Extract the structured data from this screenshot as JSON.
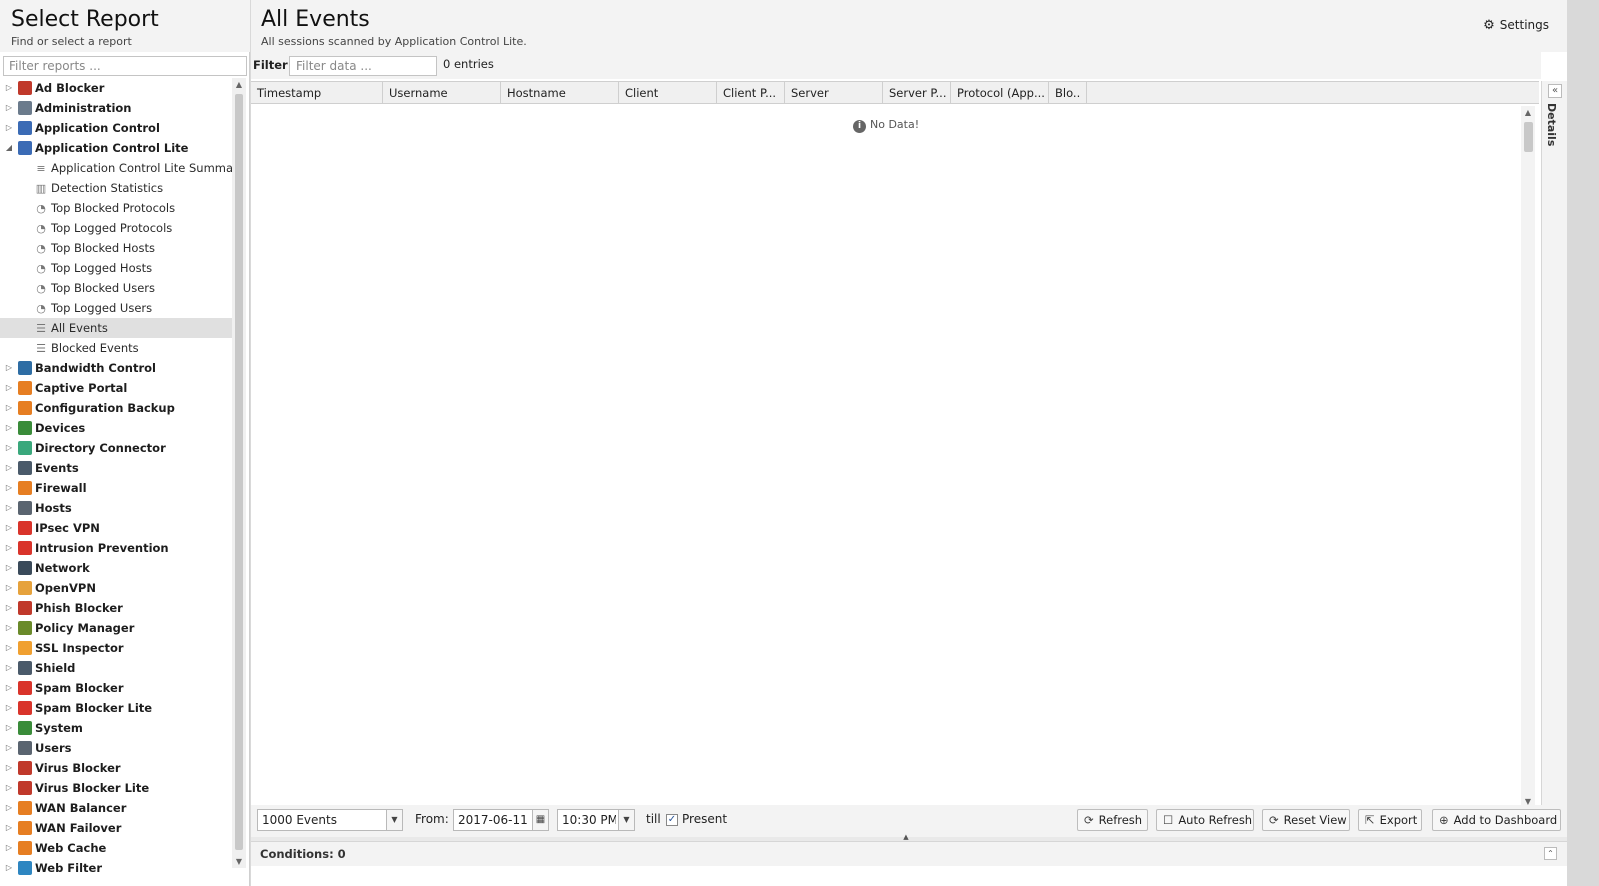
{
  "left_panel": {
    "title": "Select Report",
    "subtitle": "Find or select a report",
    "filter_placeholder": "Filter reports ..."
  },
  "tree": [
    {
      "label": "Ad Blocker",
      "type": "category",
      "color": "#c0392b",
      "expanded": false
    },
    {
      "label": "Administration",
      "type": "category",
      "color": "#6b7b8c",
      "expanded": false
    },
    {
      "label": "Application Control",
      "type": "category",
      "color": "#3b6bb5",
      "expanded": false
    },
    {
      "label": "Application Control Lite",
      "type": "category",
      "color": "#3b6bb5",
      "expanded": true
    },
    {
      "label": "Application Control Lite Summary",
      "type": "report",
      "icon": "text-report"
    },
    {
      "label": "Detection Statistics",
      "type": "report",
      "icon": "bar-chart"
    },
    {
      "label": "Top Blocked Protocols",
      "type": "report",
      "icon": "pie-chart"
    },
    {
      "label": "Top Logged Protocols",
      "type": "report",
      "icon": "pie-chart"
    },
    {
      "label": "Top Blocked Hosts",
      "type": "report",
      "icon": "pie-chart"
    },
    {
      "label": "Top Logged Hosts",
      "type": "report",
      "icon": "pie-chart"
    },
    {
      "label": "Top Blocked Users",
      "type": "report",
      "icon": "pie-chart"
    },
    {
      "label": "Top Logged Users",
      "type": "report",
      "icon": "pie-chart"
    },
    {
      "label": "All Events",
      "type": "report",
      "icon": "list",
      "selected": true
    },
    {
      "label": "Blocked Events",
      "type": "report",
      "icon": "list"
    },
    {
      "label": "Bandwidth Control",
      "type": "category",
      "color": "#2e6da4",
      "expanded": false
    },
    {
      "label": "Captive Portal",
      "type": "category",
      "color": "#e67e22",
      "expanded": false
    },
    {
      "label": "Configuration Backup",
      "type": "category",
      "color": "#e67e22",
      "expanded": false
    },
    {
      "label": "Devices",
      "type": "category",
      "color": "#3a8c3a",
      "expanded": false
    },
    {
      "label": "Directory Connector",
      "type": "category",
      "color": "#3aa87c",
      "expanded": false
    },
    {
      "label": "Events",
      "type": "category",
      "color": "#4a5a6a",
      "expanded": false
    },
    {
      "label": "Firewall",
      "type": "category",
      "color": "#e67e22",
      "expanded": false
    },
    {
      "label": "Hosts",
      "type": "category",
      "color": "#5a6470",
      "expanded": false
    },
    {
      "label": "IPsec VPN",
      "type": "category",
      "color": "#d9342b",
      "expanded": false
    },
    {
      "label": "Intrusion Prevention",
      "type": "category",
      "color": "#d9342b",
      "expanded": false
    },
    {
      "label": "Network",
      "type": "category",
      "color": "#3a4a5a",
      "expanded": false
    },
    {
      "label": "OpenVPN",
      "type": "category",
      "color": "#e6a23c",
      "expanded": false
    },
    {
      "label": "Phish Blocker",
      "type": "category",
      "color": "#c0392b",
      "expanded": false
    },
    {
      "label": "Policy Manager",
      "type": "category",
      "color": "#6a8a2a",
      "expanded": false
    },
    {
      "label": "SSL Inspector",
      "type": "category",
      "color": "#f0a030",
      "expanded": false
    },
    {
      "label": "Shield",
      "type": "category",
      "color": "#4a5a6a",
      "expanded": false
    },
    {
      "label": "Spam Blocker",
      "type": "category",
      "color": "#d9342b",
      "expanded": false
    },
    {
      "label": "Spam Blocker Lite",
      "type": "category",
      "color": "#d9342b",
      "expanded": false
    },
    {
      "label": "System",
      "type": "category",
      "color": "#3a8c3a",
      "expanded": false
    },
    {
      "label": "Users",
      "type": "category",
      "color": "#5a6470",
      "expanded": false
    },
    {
      "label": "Virus Blocker",
      "type": "category",
      "color": "#c0392b",
      "expanded": false
    },
    {
      "label": "Virus Blocker Lite",
      "type": "category",
      "color": "#c0392b",
      "expanded": false
    },
    {
      "label": "WAN Balancer",
      "type": "category",
      "color": "#e67e22",
      "expanded": false
    },
    {
      "label": "WAN Failover",
      "type": "category",
      "color": "#e67e22",
      "expanded": false
    },
    {
      "label": "Web Cache",
      "type": "category",
      "color": "#e67e22",
      "expanded": false
    },
    {
      "label": "Web Filter",
      "type": "category",
      "color": "#2e86c1",
      "expanded": false
    }
  ],
  "main": {
    "title": "All Events",
    "subtitle": "All sessions scanned by Application Control Lite.",
    "settings_label": "Settings",
    "filter_label": "Filter:",
    "filter_placeholder": "Filter data ...",
    "entries": "0 entries",
    "columns": [
      "Timestamp",
      "Username",
      "Hostname",
      "Client",
      "Client P...",
      "Server",
      "Server P...",
      "Protocol (App...",
      "Blo.."
    ],
    "no_data": "No Data!",
    "details_label": "Details"
  },
  "bottom": {
    "events_limit": "1000 Events",
    "from_label": "From:",
    "from_date": "2017-06-11",
    "from_time": "10:30 PM",
    "till_label": "till",
    "present_label": "Present",
    "present_checked": true,
    "buttons": {
      "refresh": "Refresh",
      "auto_refresh": "Auto Refresh",
      "reset_view": "Reset View",
      "export": "Export",
      "add_to_dashboard": "Add to Dashboard"
    },
    "conditions": "Conditions: 0"
  }
}
